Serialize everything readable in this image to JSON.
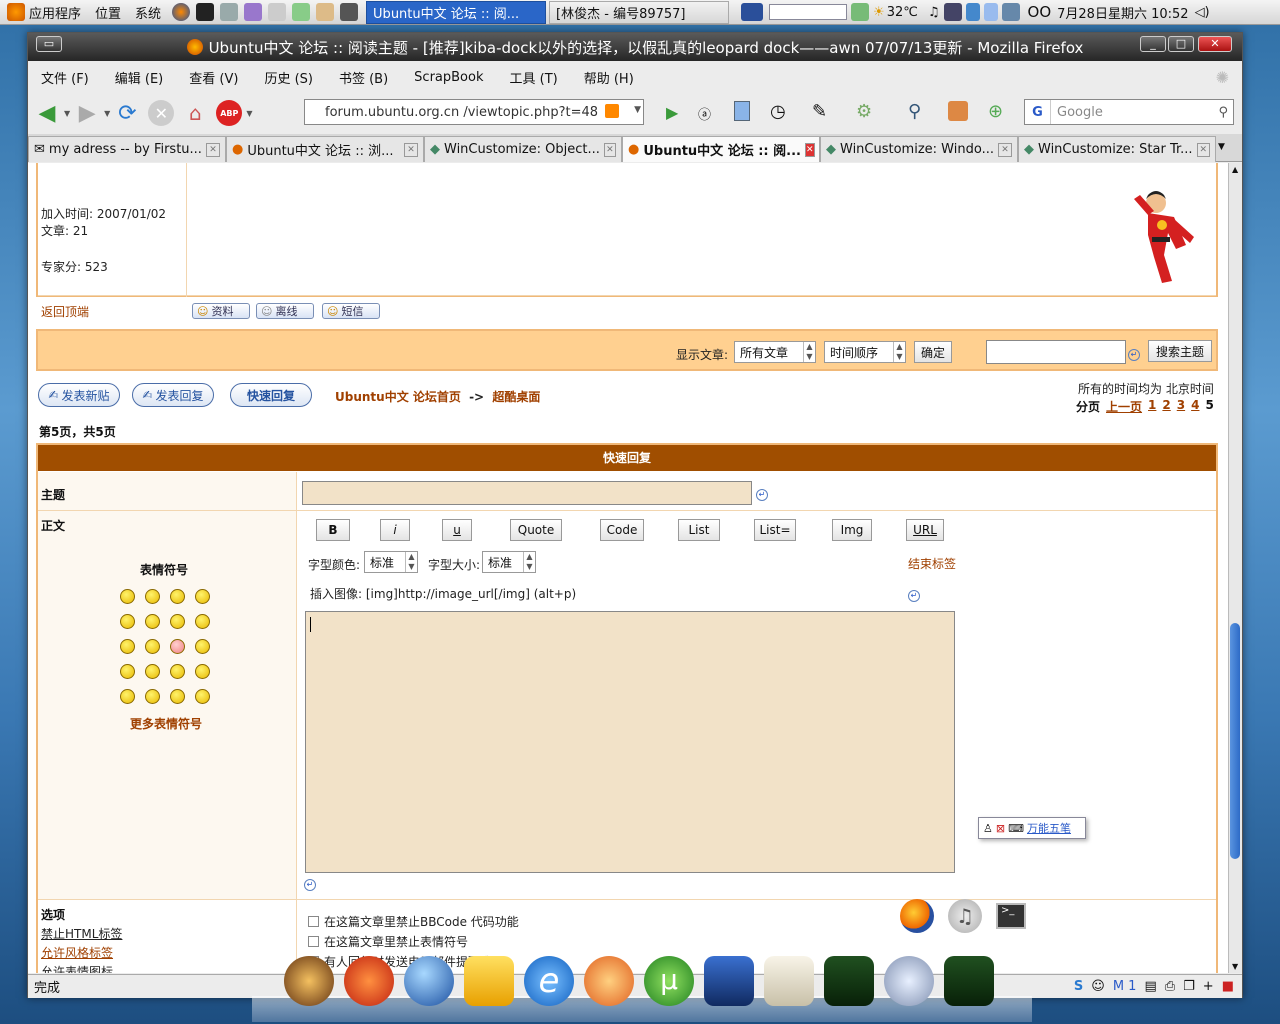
{
  "panel": {
    "menus": [
      "应用程序",
      "位置",
      "系统"
    ],
    "tasks": [
      "Ubuntu中文 论坛 :: 阅...",
      "[林俊杰 - 编号89757]"
    ],
    "weather": "32℃",
    "clock": "7月28日星期六 10:52"
  },
  "window": {
    "title": "Ubuntu中文 论坛 :: 阅读主题 - [推荐]kiba-dock以外的选择，以假乱真的leopard dock——awn 07/07/13更新 - Mozilla Firefox"
  },
  "menu": [
    "文件 (F)",
    "编辑 (E)",
    "查看 (V)",
    "历史 (S)",
    "书签 (B)",
    "ScrapBook",
    "工具 (T)",
    "帮助 (H)"
  ],
  "urlbar": {
    "value": "forum.ubuntu.org.cn       /viewtopic.php?t=48"
  },
  "search": {
    "placeholder": "Google"
  },
  "tabs": [
    "my adress -- by Firstu...",
    "Ubuntu中文 论坛 :: 浏...",
    "WinCustomize: Object...",
    "Ubuntu中文 论坛 :: 阅...",
    "WinCustomize: Windo...",
    "WinCustomize: Star Tr..."
  ],
  "profile": {
    "joined": "加入时间: 2007/01/02",
    "posts": "文章: 21",
    "score": "专家分: 523",
    "back_to_top": "返回顶端",
    "btn_profile": "资料",
    "btn_offline": "离线",
    "btn_pm": "短信"
  },
  "filter": {
    "label": "显示文章:",
    "select1": "所有文章",
    "select2": "时间顺序",
    "ok": "确定",
    "search_btn": "搜索主题"
  },
  "actions": {
    "new_topic": "发表新贴",
    "reply": "发表回复",
    "quick_reply": "快速回复"
  },
  "breadcrumb": {
    "home": "Ubuntu中文 论坛首页",
    "sep": "->",
    "forum": "超酷桌面"
  },
  "timezone": "所有的时间均为 北京时间",
  "pagination": {
    "label": "分页",
    "prev": "上一页",
    "pages": [
      "1",
      "2",
      "3",
      "4"
    ],
    "current": "5"
  },
  "page_info": "第5页，共5页",
  "quick": {
    "header": "快速回复",
    "subject_label": "主题",
    "body_label": "正文",
    "smilies_title": "表情符号",
    "more_smilies": "更多表情符号",
    "bbcode": [
      "B",
      "i",
      "u",
      "Quote",
      "Code",
      "List",
      "List=",
      "Img",
      "URL"
    ],
    "font_color_label": "字型颜色:",
    "font_color": "标准",
    "font_size_label": "字型大小:",
    "font_size": "标准",
    "close_tags": "结束标签",
    "insert_image": "插入图像: [img]http://image_url[/img]  (alt+p)"
  },
  "options": {
    "title": "选项",
    "html": "禁止HTML标签",
    "bbcode": "允许风格标签",
    "smilies": "允许表情图标",
    "cb1": "在这篇文章里禁止BBCode 代码功能",
    "cb2": "在这篇文章里禁止表情符号",
    "cb3": "有人回复时发送电子邮件提醒我"
  },
  "ime": "万能五笔",
  "status": "完成",
  "colors": {
    "header": "#a04e00",
    "frame": "#f0b878",
    "accent": "#a04000",
    "filterbg": "#ffd090",
    "textarea": "#f2e2c8"
  }
}
